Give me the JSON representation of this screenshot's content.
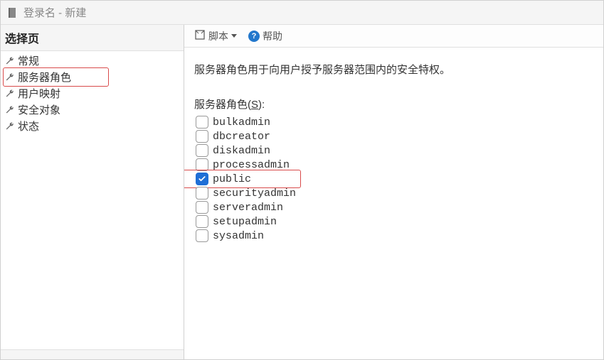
{
  "title": "登录名 - 新建",
  "sidebar": {
    "header": "选择页",
    "items": [
      {
        "label": "常规"
      },
      {
        "label": "服务器角色"
      },
      {
        "label": "用户映射"
      },
      {
        "label": "安全对象"
      },
      {
        "label": "状态"
      }
    ],
    "footer": ""
  },
  "toolbar": {
    "script_label": "脚本",
    "help_label": "帮助"
  },
  "main": {
    "description": "服务器角色用于向用户授予服务器范围内的安全特权。",
    "roles_label_prefix": "服务器角色(",
    "roles_label_key": "S",
    "roles_label_suffix": "):",
    "roles": [
      {
        "name": "bulkadmin",
        "checked": false
      },
      {
        "name": "dbcreator",
        "checked": false
      },
      {
        "name": "diskadmin",
        "checked": false
      },
      {
        "name": "processadmin",
        "checked": false
      },
      {
        "name": "public",
        "checked": true
      },
      {
        "name": "securityadmin",
        "checked": false
      },
      {
        "name": "serveradmin",
        "checked": false
      },
      {
        "name": "setupadmin",
        "checked": false
      },
      {
        "name": "sysadmin",
        "checked": false
      }
    ]
  }
}
